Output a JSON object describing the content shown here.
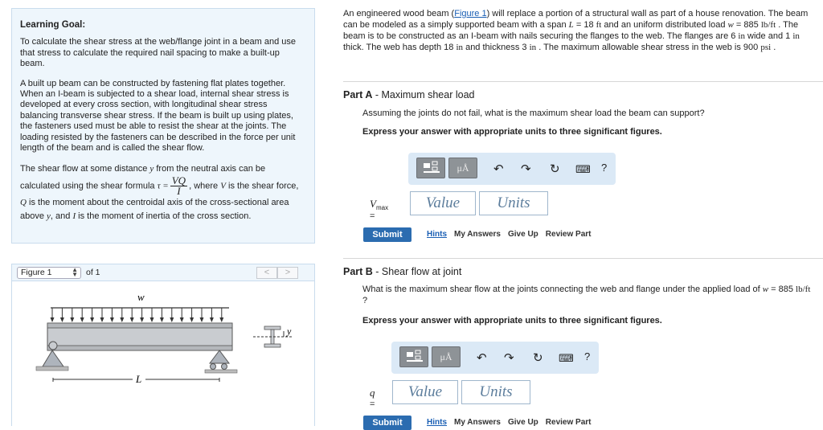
{
  "learning_goal": {
    "heading": "Learning Goal:",
    "goal_text": "To calculate the shear stress at the web/flange joint in a beam and use that stress to calculate the required nail spacing to make a built-up beam.",
    "paragraph1": "A built up beam can be constructed by fastening flat plates together. When an I-beam is subjected to a shear load, internal shear stress is developed at every cross section, with longitudinal shear stress balancing transverse shear stress. If the beam is built up using plates, the fasteners used must be able to resist the shear at the joints. The loading resisted by the fasteners can be described in the force per unit length of the beam and is called the shear flow.",
    "p2_a": "The shear flow at some distance ",
    "p2_y": "y",
    "p2_b": " from the neutral axis can be calculated using the shear formula ",
    "tau": "τ =",
    "frac_num": "VQ",
    "frac_den": "I",
    "p2_c": ", where ",
    "V": "V",
    "p2_d": " is the shear force, ",
    "Q": "Q",
    "p2_e": " is the moment about the centroidal axis of the cross-sectional area above ",
    "y2": "y",
    "p2_f": ", and ",
    "I": "I",
    "p2_g": " is the moment of inertia of the cross section."
  },
  "figure": {
    "select_value": "Figure 1",
    "of_text": "of 1",
    "prev": "<",
    "next": ">",
    "load_label": "w",
    "span_label": "L",
    "axis_label": "y"
  },
  "intro": {
    "t1": "An engineered wood beam (",
    "link": "Figure 1",
    "t2": ") will replace a portion of a structural wall as part of a house renovation. The beam can be modeled as a simply supported beam with a span ",
    "L": "L",
    "t3": " = 18 ",
    "ft": "ft",
    "t4": " and an uniform distributed load ",
    "w": "w",
    "t5": " = 885 ",
    "lbft": "lb/ft",
    "t6": " . The beam is to be constructed as an I-beam with nails securing the flanges to the web. The flanges are 6 ",
    "in1": "in",
    "t7": " wide and 1 ",
    "in2": "in",
    "t8": " thick. The web has depth 18 ",
    "in3": "in",
    "t9": " and thickness 3 ",
    "in4": "in",
    "t10": " . The maximum allowable shear stress in the web is 900 ",
    "psi": "psi",
    "t11": " ."
  },
  "partA": {
    "part": "Part A",
    "title": " - Maximum shear load",
    "question": "Assuming the joints do not fail, what is the maximum shear load the beam can support?",
    "instruction": "Express your answer with appropriate units to three significant figures.",
    "mu": "μÅ",
    "help": "?",
    "label_var": "V",
    "label_sub": "max",
    "label_eq": " =",
    "value_ph": "Value",
    "units_ph": "Units",
    "submit": "Submit",
    "hints": "Hints",
    "my_answers": "My Answers",
    "give_up": "Give Up",
    "review": "Review Part"
  },
  "partB": {
    "part": "Part B",
    "title": " - Shear flow at joint",
    "question_a": "What is the maximum shear flow at the joints connecting the web and flange under the applied load of ",
    "w": "w",
    "question_b": " = 885 ",
    "lbft": "lb/ft",
    "question_c": " ?",
    "instruction": "Express your answer with appropriate units to three significant figures.",
    "mu": "μÅ",
    "help": "?",
    "label_var": "q",
    "label_eq": " =",
    "value_ph": "Value",
    "units_ph": "Units",
    "submit": "Submit",
    "hints": "Hints",
    "my_answers": "My Answers",
    "give_up": "Give Up",
    "review": "Review Part"
  }
}
